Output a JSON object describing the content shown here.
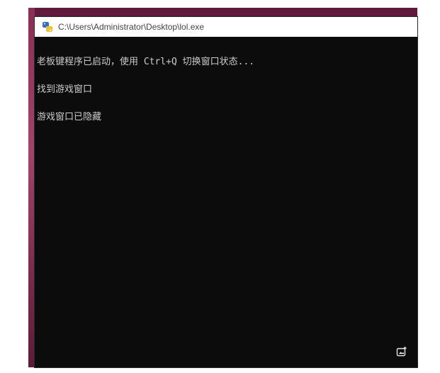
{
  "window": {
    "title": "C:\\Users\\Administrator\\Desktop\\lol.exe",
    "app_icon": "python-icon"
  },
  "console": {
    "lines": [
      "老板键程序已启动，使用 Ctrl+Q 切换窗口状态...",
      "找到游戏窗口",
      "游戏窗口已隐藏"
    ]
  },
  "overlay": {
    "icon": "screenshot-icon"
  },
  "colors": {
    "console_background": "#0c0c0c",
    "console_text": "#cccccc",
    "titlebar_background": "#ffffff",
    "wallpaper": "#5e1a3a"
  }
}
